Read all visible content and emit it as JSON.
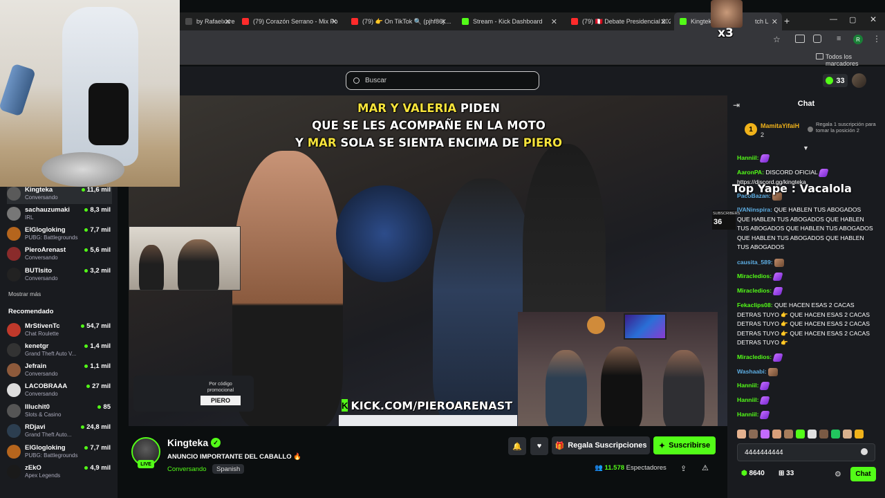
{
  "browser": {
    "tabs": [
      {
        "label": "by RafaelxaredI",
        "color": "#4a4a4a"
      },
      {
        "label": "(79) Corazón Serrano - Mix Po",
        "color": "#ff2b2b"
      },
      {
        "label": "(79) 👉 On TikTok 🔍 (pjhf86) ...",
        "color": "#ff2b2b"
      },
      {
        "label": "Stream - Kick Dashboard",
        "color": "#53fc18"
      },
      {
        "label": "(79) 🇵🇪 Debate Presidencial 202",
        "color": "#ff2b2b"
      },
      {
        "label": "Kingteka",
        "color": "#53fc18"
      }
    ],
    "active_tab_suffix": "tch L",
    "bookmarks_label": "Todos los marcadores",
    "profile_letter": "R"
  },
  "header": {
    "search_placeholder": "Buscar",
    "points": "33"
  },
  "sidebar": {
    "following": [
      {
        "name": "Kingteka",
        "category": "Conversando",
        "viewers": "11,6 mil",
        "avatar": "#5a5a5a"
      },
      {
        "name": "sachauzumaki",
        "category": "IRL",
        "viewers": "8,3 mil",
        "avatar": "#777"
      },
      {
        "name": "ElGlogloking",
        "category": "PUBG: Battlegrounds",
        "viewers": "7,7 mil",
        "avatar": "#b5651d"
      },
      {
        "name": "PieroArenast",
        "category": "Conversando",
        "viewers": "5,6 mil",
        "avatar": "#8a2b2b"
      },
      {
        "name": "BUTIsito",
        "category": "Conversando",
        "viewers": "3,2 mil",
        "avatar": "#222"
      }
    ],
    "show_more": "Mostrar más",
    "recommended_title": "Recomendado",
    "recommended": [
      {
        "name": "MrStivenTc",
        "category": "Chat Roulette",
        "viewers": "54,7 mil",
        "avatar": "#c0392b"
      },
      {
        "name": "kenetgr",
        "category": "Grand Theft Auto V...",
        "viewers": "1,4 mil",
        "avatar": "#333"
      },
      {
        "name": "Jefrain",
        "category": "Conversando",
        "viewers": "1,1 mil",
        "avatar": "#8e5a3b"
      },
      {
        "name": "LACOBRAAA",
        "category": "Conversando",
        "viewers": "27 mil",
        "avatar": "#ddd"
      },
      {
        "name": "Illuchit0",
        "category": "Slots & Casino",
        "viewers": "85",
        "avatar": "#555"
      },
      {
        "name": "RDjavi",
        "category": "Grand Theft Auto...",
        "viewers": "24,8 mil",
        "avatar": "#2c3e50"
      },
      {
        "name": "ElGlogloking",
        "category": "PUBG: Battlegrounds",
        "viewers": "7,7 mil",
        "avatar": "#b5651d"
      },
      {
        "name": "zEkO",
        "category": "Apex Legends",
        "viewers": "4,9 mil",
        "avatar": "#1a1a1a"
      }
    ]
  },
  "video": {
    "caption_l1_a": "MAR Y VALERIA",
    "caption_l1_b": " PIDEN",
    "caption_l2": "QUE SE LES ACOMPAÑE EN LA MOTO",
    "caption_l3_a": "Y ",
    "caption_l3_b": "MAR",
    "caption_l3_c": " SOLA SE SIENTA ENCIMA DE ",
    "caption_l3_d": "PIERO",
    "promo_line": "Por código promocional",
    "promo_code": "PIERO",
    "kick_url": "KICK.COM/PIEROARENAST",
    "top_yape": "Top Yape : Vacalola",
    "subs_label": "SUBSCRIBERS",
    "subs_count": "36",
    "multiplier": "x3"
  },
  "stream": {
    "streamer": "Kingteka",
    "live": "LIVE",
    "title": "ANUNCIO IMPORTANTE DEL CABALLO 🔥",
    "category": "Conversando",
    "language": "Spanish",
    "gift_label": "Regala Suscripciones",
    "subscribe_label": "Suscribirse",
    "viewers": "11.578",
    "viewers_label": "Espectadores"
  },
  "chat": {
    "title": "Chat",
    "pinned_rank": "1",
    "pinned_user": "MamitaYifaiH",
    "pinned_count": "2",
    "pinned_desc": "Regala 1 suscripción para tomar la posición 2",
    "messages": [
      {
        "user": "Hanniil:",
        "text": "",
        "color": "#53fc18",
        "emote": "purple"
      },
      {
        "user": "AaronPA:",
        "text": " DISCORD OFICIAL",
        "color": "#53fc18",
        "emote": "purple"
      },
      {
        "user": "",
        "text": "https://discord.gg/kingteka",
        "color": "#fff",
        "emote": ""
      },
      {
        "user": "PacoBazan:",
        "text": "",
        "color": "#5dade2",
        "emote": "img"
      },
      {
        "user": "IVANinspira:",
        "text": " QUE HABLEN TUS ABOGADOS QUE HABLEN TUS ABOGADOS QUE HABLEN TUS ABOGADOS QUE HABLEN TUS ABOGADOS QUE HABLEN TUS ABOGADOS QUE HABLEN TUS ABOGADOS",
        "color": "#5dade2",
        "emote": ""
      },
      {
        "user": "causita_589:",
        "text": "",
        "color": "#5dade2",
        "emote": "img"
      },
      {
        "user": "Miracledios:",
        "text": "",
        "color": "#53fc18",
        "emote": "purple"
      },
      {
        "user": "Miracledios:",
        "text": "",
        "color": "#53fc18",
        "emote": "purple"
      },
      {
        "user": "Fekaclips08:",
        "text": " QUE HACEN ESAS 2 CACAS DETRAS TUYO 👉 QUE HACEN ESAS 2 CACAS DETRAS TUYO 👉 QUE HACEN ESAS 2 CACAS DETRAS TUYO 👉 QUE HACEN ESAS 2 CACAS DETRAS TUYO 👉",
        "color": "#53fc18",
        "emote": ""
      },
      {
        "user": "Miracledios:",
        "text": "",
        "color": "#53fc18",
        "emote": "purple"
      },
      {
        "user": "Washaabi:",
        "text": "",
        "color": "#5dade2",
        "emote": "img"
      },
      {
        "user": "Hanniil:",
        "text": "",
        "color": "#53fc18",
        "emote": "purple"
      },
      {
        "user": "Hanniil:",
        "text": "",
        "color": "#53fc18",
        "emote": "purple"
      },
      {
        "user": "Hanniil:",
        "text": "",
        "color": "#53fc18",
        "emote": "purple"
      }
    ],
    "input_value": "4444444444",
    "points": "8640",
    "subs": "33",
    "send_label": "Chat"
  }
}
